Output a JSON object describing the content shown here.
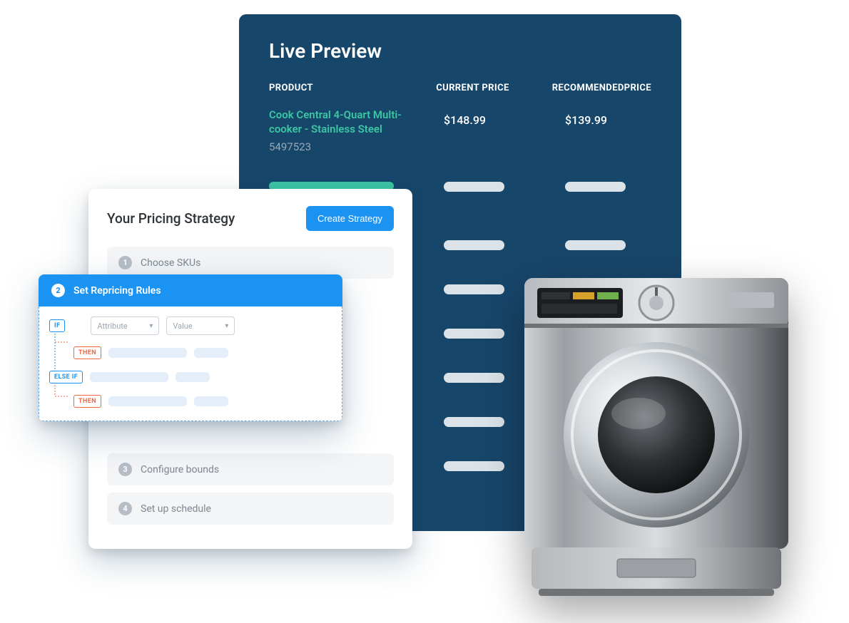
{
  "livePreview": {
    "title": "Live Preview",
    "columns": {
      "product": "PRODUCT",
      "current": "CURRENT PRICE",
      "recommended": "RECOMMENDEDPRICE"
    },
    "featured": {
      "name": "Cook Central 4-Quart Multi-cooker - Stainless Steel",
      "sku": "5497523",
      "currentPrice": "$148.99",
      "recommendedPrice": "$139.99"
    }
  },
  "strategy": {
    "title": "Your Pricing Strategy",
    "createButton": "Create Strategy",
    "steps": {
      "s1": "Choose SKUs",
      "s3": "Configure bounds",
      "s4": "Set up schedule"
    }
  },
  "rules": {
    "headerTitle": "Set Repricing Rules",
    "tags": {
      "if": "IF",
      "then1": "THEN",
      "elseif": "ELSE IF",
      "then2": "THEN"
    },
    "placeholders": {
      "attribute": "Attribute",
      "value": "Value"
    }
  },
  "stepNumbers": {
    "n1": "1",
    "n2": "2",
    "n3": "3",
    "n4": "4"
  }
}
